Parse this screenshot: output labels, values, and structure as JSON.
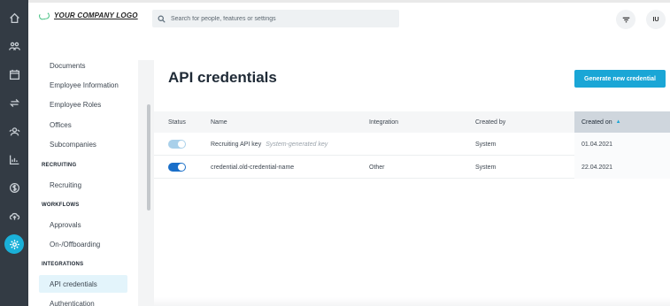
{
  "brand": {
    "logo_text": "YOUR COMPANY LOGO"
  },
  "search": {
    "placeholder": "Search for people, features or settings"
  },
  "topbar": {
    "user_initials": "IU"
  },
  "rail": {
    "icons": [
      "home-icon",
      "people-icon",
      "calendar-icon",
      "sync-icon",
      "group-icon",
      "chart-icon",
      "dollar-icon",
      "cloud-upload-icon",
      "settings-icon"
    ],
    "active": "settings-icon"
  },
  "sidebar": {
    "items_top": [
      {
        "label": "Documents"
      },
      {
        "label": "Employee Information"
      },
      {
        "label": "Employee Roles"
      },
      {
        "label": "Offices"
      },
      {
        "label": "Subcompanies"
      }
    ],
    "sections": [
      {
        "header": "RECRUITING",
        "items": [
          {
            "label": "Recruiting"
          }
        ]
      },
      {
        "header": "WORKFLOWS",
        "items": [
          {
            "label": "Approvals"
          },
          {
            "label": "On-/Offboarding"
          }
        ]
      },
      {
        "header": "INTEGRATIONS",
        "items": [
          {
            "label": "API credentials"
          },
          {
            "label": "Authentication"
          }
        ]
      }
    ]
  },
  "main": {
    "title": "API credentials",
    "primary_button": "Generate new credential",
    "table": {
      "columns": [
        "Status",
        "Name",
        "Integration",
        "Created by",
        "Created on"
      ],
      "sorted_column": "Created on",
      "sort_indicator": "▲",
      "rows": [
        {
          "status": "enabled-disabled",
          "name": "Recruiting API key",
          "note": "System-generated key",
          "integration": "",
          "created_by": "System",
          "created_on": "01.04.2021"
        },
        {
          "status": "enabled",
          "name": "credential.old-credential-name",
          "note": "",
          "integration": "Other",
          "created_by": "System",
          "created_on": "22.04.2021"
        }
      ]
    }
  },
  "colors": {
    "rail_bg": "#333b44",
    "accent": "#1aa6d6",
    "toggle_on": "#1a6fc9",
    "toggle_locked": "#a9d0ea"
  }
}
